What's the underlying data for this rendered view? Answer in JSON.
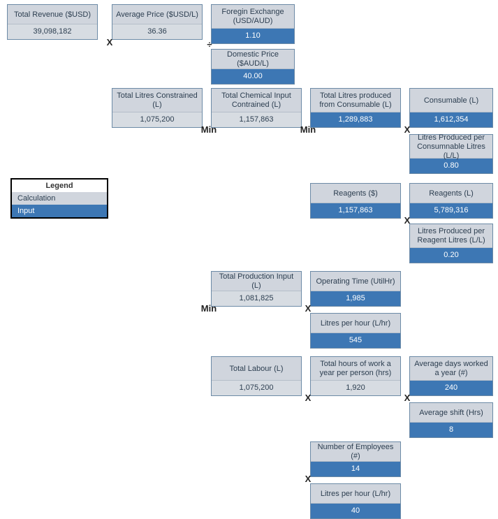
{
  "legend": {
    "title": "Legend",
    "calc": "Calculation",
    "input": "Input"
  },
  "ops": {
    "mult": "X",
    "div": "÷",
    "min": "Min"
  },
  "nodes": {
    "total_revenue": {
      "label": "Total Revenue ($USD)",
      "value": "39,098,182"
    },
    "average_price": {
      "label": "Average Price ($USD/L)",
      "value": "36.36"
    },
    "foreign_exchange": {
      "label": "Foregin Exchange (USD/AUD)",
      "value": "1.10"
    },
    "domestic_price": {
      "label": "Domestic Price ($AUD/L)",
      "value": "40.00"
    },
    "total_litres_constrained": {
      "label": "Total Litres Constrained (L)",
      "value": "1,075,200"
    },
    "total_chem_input": {
      "label": "Total  Chemical Input Contrained (L)",
      "value": "1,157,863"
    },
    "total_litres_consumable": {
      "label": "Total Litres produced from Consumable (L)",
      "value": "1,289,883"
    },
    "consumable_l": {
      "label": "Consumable (L)",
      "value": "1,612,354"
    },
    "litres_per_consumable": {
      "label": "Litres Produced per Consumnable Litres (L/L)",
      "value": "0.80"
    },
    "reagents_dollar": {
      "label": "Reagents ($)",
      "value": "1,157,863"
    },
    "reagents_l": {
      "label": "Reagents (L)",
      "value": "5,789,316"
    },
    "litres_per_reagent": {
      "label": "Litres Produced per Reagent Litres (L/L)",
      "value": "0.20"
    },
    "total_production_input": {
      "label": "Total Production Input (L)",
      "value": "1,081,825"
    },
    "operating_time": {
      "label": "Operating Time (UtilHr)",
      "value": "1,985"
    },
    "litres_per_hour_prod": {
      "label": "Litres per hour (L/hr)",
      "value": "545"
    },
    "total_labour": {
      "label": "Total Labour (L)",
      "value": "1,075,200"
    },
    "total_hours_per_person": {
      "label": "Total hours of work a year per person (hrs)",
      "value": "1,920"
    },
    "avg_days_worked": {
      "label": "Average days worked a year (#)",
      "value": "240"
    },
    "avg_shift": {
      "label": "Average shift (Hrs)",
      "value": "8"
    },
    "number_of_employees": {
      "label": "Number of Employees (#)",
      "value": "14"
    },
    "litres_per_hour_labour": {
      "label": "Litres per hour (L/hr)",
      "value": "40"
    }
  }
}
